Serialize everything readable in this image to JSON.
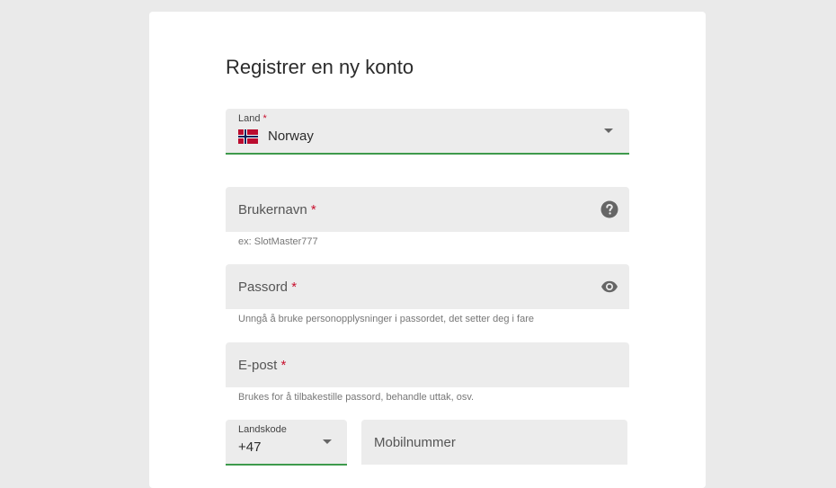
{
  "form": {
    "title": "Registrer en ny konto",
    "country": {
      "label": "Land",
      "required_mark": "*",
      "value": "Norway"
    },
    "username": {
      "placeholder": "Brukernavn",
      "required_mark": "*",
      "hint": "ex: SlotMaster777"
    },
    "password": {
      "placeholder": "Passord",
      "required_mark": "*",
      "hint": "Unngå å bruke personopplysninger i passordet, det setter deg i fare"
    },
    "email": {
      "placeholder": "E-post",
      "required_mark": "*",
      "hint": "Brukes for å tilbakestille passord, behandle uttak, osv."
    },
    "country_code": {
      "label": "Landskode",
      "value": "+47"
    },
    "mobile": {
      "placeholder": "Mobilnummer"
    }
  },
  "colors": {
    "accent_underline": "#3e9a4c",
    "required": "#c8102e",
    "field_bg": "#ececec",
    "page_bg": "#eaeaea"
  },
  "icons": {
    "country_flag": "norway-flag-icon",
    "dropdown": "chevron-down-icon",
    "help": "question-circle-icon",
    "visibility": "eye-icon"
  }
}
